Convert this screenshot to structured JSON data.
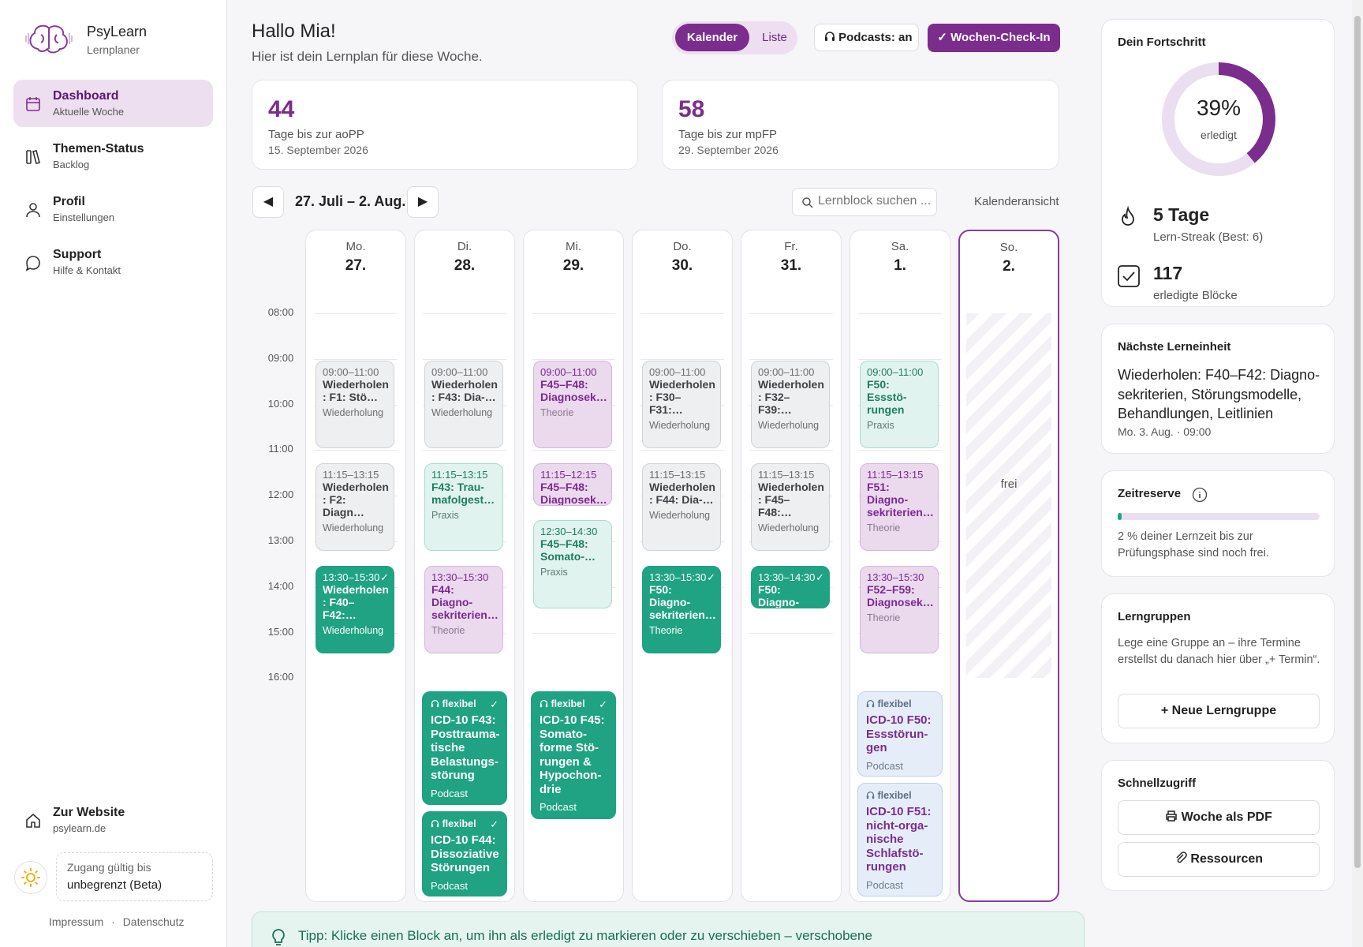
{
  "sidebar": {
    "brand": {
      "name": "PsyLearn",
      "subtitle": "Lernplaner"
    },
    "nav": [
      {
        "title": "Dashboard",
        "subtitle": "Aktuelle Woche",
        "icon": "calendar-icon",
        "active": true
      },
      {
        "title": "Themen-Status",
        "subtitle": "Backlog",
        "icon": "books-icon"
      },
      {
        "title": "Profil",
        "subtitle": "Einstellungen",
        "icon": "user-icon"
      },
      {
        "title": "Support",
        "subtitle": "Hilfe & Kontakt",
        "icon": "chat-icon"
      }
    ],
    "website": {
      "title": "Zur Website",
      "subtitle": "psylearn.de",
      "icon": "home-icon"
    },
    "access": {
      "label": "Zugang gültig bis",
      "value": "unbegrenzt (Beta)"
    },
    "links": {
      "impressum": "Impressum",
      "sep": "·",
      "datenschutz": "Datenschutz"
    }
  },
  "header": {
    "greeting": "Hallo Mia!",
    "subtitle": "Hier ist dein Lernplan für diese Woche.",
    "view_calendar": "Kalender",
    "view_list": "Liste",
    "podcasts": "Podcasts: an",
    "checkin": "✓ Wochen-Check-In"
  },
  "stats": [
    {
      "value": "44",
      "label": "Tage bis zur aoPP",
      "date": "15. September 2026"
    },
    {
      "value": "58",
      "label": "Tage bis zur mpFP",
      "date": "29. September 2026"
    }
  ],
  "week": {
    "range": "27. Juli – 2. Aug.",
    "prev": "◀",
    "next": "▶",
    "search_placeholder": "Lernblock suchen ...",
    "view_toggle": "Kalenderansicht"
  },
  "hours": [
    "08:00",
    "09:00",
    "10:00",
    "11:00",
    "12:00",
    "13:00",
    "14:00",
    "15:00",
    "16:00"
  ],
  "days": [
    {
      "name": "Mo.",
      "date": "27.",
      "blocks": [
        {
          "time": "09:00–11:00",
          "title": "Wiederholen : F1: Stö…",
          "kind": "Wiederholung",
          "style": "rev",
          "start": 9,
          "end": 11
        },
        {
          "time": "11:15–13:15",
          "title": "Wiederholen : F2: Diagn…",
          "kind": "Wiederholung",
          "style": "rev",
          "start": 11.25,
          "end": 13.25
        },
        {
          "time": "13:30–15:30",
          "title": "Wiederholen : F40–F42:…",
          "kind": "Wiederholung",
          "style": "don",
          "start": 13.5,
          "end": 15.5,
          "done": true
        }
      ],
      "flex": []
    },
    {
      "name": "Di.",
      "date": "28.",
      "blocks": [
        {
          "time": "09:00–11:00",
          "title": "Wiederholen : F43: Dia-…",
          "kind": "Wiederholung",
          "style": "rev",
          "start": 9,
          "end": 11
        },
        {
          "time": "11:15–13:15",
          "title": "F43: Trau-mafolgest…",
          "kind": "Praxis",
          "style": "pra",
          "start": 11.25,
          "end": 13.25
        },
        {
          "time": "13:30–15:30",
          "title": "F44: Diagno-sekriterien…",
          "kind": "Theorie",
          "style": "the",
          "start": 13.5,
          "end": 15.5
        }
      ],
      "flex": [
        {
          "tag": "flexibel",
          "title": "ICD-10 F43: Posttrauma-tische Belastungs-störung",
          "kind": "Podcast",
          "style": "pg",
          "done": true
        },
        {
          "tag": "flexibel",
          "title": "ICD-10 F44: Dissoziative Störungen",
          "kind": "Podcast",
          "style": "pg",
          "done": true
        }
      ]
    },
    {
      "name": "Mi.",
      "date": "29.",
      "blocks": [
        {
          "time": "09:00–11:00",
          "title": "F45–F48: Diagnosek…",
          "kind": "Theorie",
          "style": "the",
          "start": 9,
          "end": 11
        },
        {
          "time": "11:15–12:15",
          "title": "F45–F48: Diagnosek…",
          "kind": "",
          "style": "the",
          "start": 11.25,
          "end": 12.25
        },
        {
          "time": "12:30–14:30",
          "title": "F45–F48: Somato-…",
          "kind": "Praxis",
          "style": "pra",
          "start": 12.5,
          "end": 14.5
        }
      ],
      "flex": [
        {
          "tag": "flexibel",
          "title": "ICD-10 F45: Somato-forme Stö-rungen & Hypochon-drie",
          "kind": "Podcast",
          "style": "pg",
          "done": true
        }
      ]
    },
    {
      "name": "Do.",
      "date": "30.",
      "blocks": [
        {
          "time": "09:00–11:00",
          "title": "Wiederholen : F30–F31:…",
          "kind": "Wiederholung",
          "style": "rev",
          "start": 9,
          "end": 11
        },
        {
          "time": "11:15–13:15",
          "title": "Wiederholen : F44: Dia-…",
          "kind": "Wiederholung",
          "style": "rev",
          "start": 11.25,
          "end": 13.25
        },
        {
          "time": "13:30–15:30",
          "title": "F50: Diagno-sekriterien…",
          "kind": "Theorie",
          "style": "don",
          "start": 13.5,
          "end": 15.5,
          "done": true
        }
      ],
      "flex": []
    },
    {
      "name": "Fr.",
      "date": "31.",
      "blocks": [
        {
          "time": "09:00–11:00",
          "title": "Wiederholen : F32–F39:…",
          "kind": "Wiederholung",
          "style": "rev",
          "start": 9,
          "end": 11
        },
        {
          "time": "11:15–13:15",
          "title": "Wiederholen : F45–F48:…",
          "kind": "Wiederholung",
          "style": "rev",
          "start": 11.25,
          "end": 13.25
        },
        {
          "time": "13:30–14:30",
          "title": "F50: Diagno-sekriterien…",
          "kind": "",
          "style": "don",
          "start": 13.5,
          "end": 14.5,
          "done": true
        }
      ],
      "flex": []
    },
    {
      "name": "Sa.",
      "date": "1.",
      "blocks": [
        {
          "time": "09:00–11:00",
          "title": "F50: Essstö-rungen",
          "kind": "Praxis",
          "style": "pra",
          "start": 9,
          "end": 11
        },
        {
          "time": "11:15–13:15",
          "title": "F51: Diagno-sekriterien…",
          "kind": "Theorie",
          "style": "the",
          "start": 11.25,
          "end": 13.25
        },
        {
          "time": "13:30–15:30",
          "title": "F52–F59: Diagnosek…",
          "kind": "Theorie",
          "style": "the",
          "start": 13.5,
          "end": 15.5
        }
      ],
      "flex": [
        {
          "tag": "flexibel",
          "title": "ICD-10 F50: Essstörun-gen",
          "kind": "Podcast",
          "style": "pb"
        },
        {
          "tag": "flexibel",
          "title": "ICD-10 F51: nicht-orga-nische Schlafstö-rungen",
          "kind": "Podcast",
          "style": "pb"
        }
      ]
    },
    {
      "name": "So.",
      "date": "2.",
      "blocks": [],
      "flex": [],
      "free": "frei"
    }
  ],
  "tip": "Tipp: Klicke einen Block an, um ihn als erledigt zu markieren oder zu verschieben – verschobene",
  "progress": {
    "title": "Dein Fortschritt",
    "percent_label": "39%",
    "percent": 39,
    "done_label": "erledigt",
    "streak": "5 Tage",
    "streak_sub": "Lern-Streak (Best: 6)",
    "blocks": "117",
    "blocks_sub": "erledigte Blöcke"
  },
  "next": {
    "title": "Nächste Lerneinheit",
    "text": "Wiederholen: F40–F42: Diagno-sekriterien, Störungsmodelle, Behandlungen, Leitlinien",
    "when": "Mo. 3. Aug. · 09:00"
  },
  "reserve": {
    "title": "Zeitreserve",
    "percent": 2,
    "text": "2 % deiner Lernzeit bis zur Prüfungsphase sind noch frei."
  },
  "groups": {
    "title": "Lerngruppen",
    "text": "Lege eine Gruppe an – ihre Termine erstellst du danach hier über „+ Termin“.",
    "button": "+ Neue Lerngruppe"
  },
  "quick": {
    "title": "Schnellzugriff",
    "pdf": "Woche als PDF",
    "resources": "Ressourcen"
  },
  "colors": {
    "accent": "#7b2d8d",
    "done": "#1fa382",
    "accent_light": "#eddff0"
  }
}
